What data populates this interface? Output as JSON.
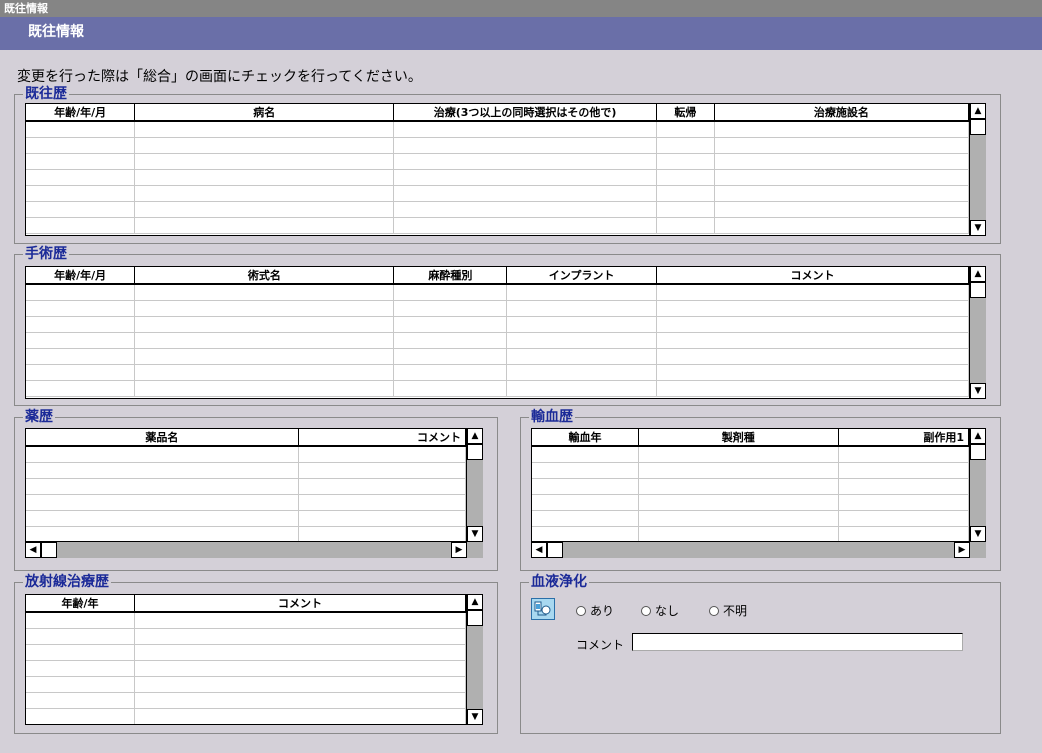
{
  "window_title": "既往情報",
  "header_title": "既往情報",
  "notice": "変更を行った際は「総合」の画面にチェックを行ってください。",
  "past_illness": {
    "title": "既往歴",
    "columns": [
      "年齢/年/月",
      "病名",
      "治療(3つ以上の同時選択はその他で)",
      "転帰",
      "治療施設名"
    ],
    "rows": 7
  },
  "surgery": {
    "title": "手術歴",
    "columns": [
      "年齢/年/月",
      "術式名",
      "麻酔種別",
      "インプラント",
      "コメント"
    ],
    "rows": 7
  },
  "medication": {
    "title": "薬歴",
    "columns": [
      "薬品名",
      "コメント"
    ],
    "rows": 6
  },
  "transfusion": {
    "title": "輸血歴",
    "columns": [
      "輸血年",
      "製剤種",
      "副作用1"
    ],
    "rows": 6
  },
  "radiation": {
    "title": "放射線治療歴",
    "columns": [
      "年齢/年",
      "コメント"
    ],
    "rows": 7
  },
  "blood_purification": {
    "title": "血液浄化",
    "options": [
      "あり",
      "なし",
      "不明"
    ],
    "comment_label": "コメント",
    "comment_value": ""
  },
  "icons": {
    "scroll_up": "up-arrow-icon",
    "scroll_down": "down-arrow-icon",
    "scroll_left": "left-arrow-icon",
    "scroll_right": "right-arrow-icon",
    "dialysis": "dialysis-icon"
  },
  "colors": {
    "header_bar": "#6a6fa8",
    "title_bar": "#858585",
    "group_title": "#1b2a98",
    "background": "#d4d0d8"
  }
}
